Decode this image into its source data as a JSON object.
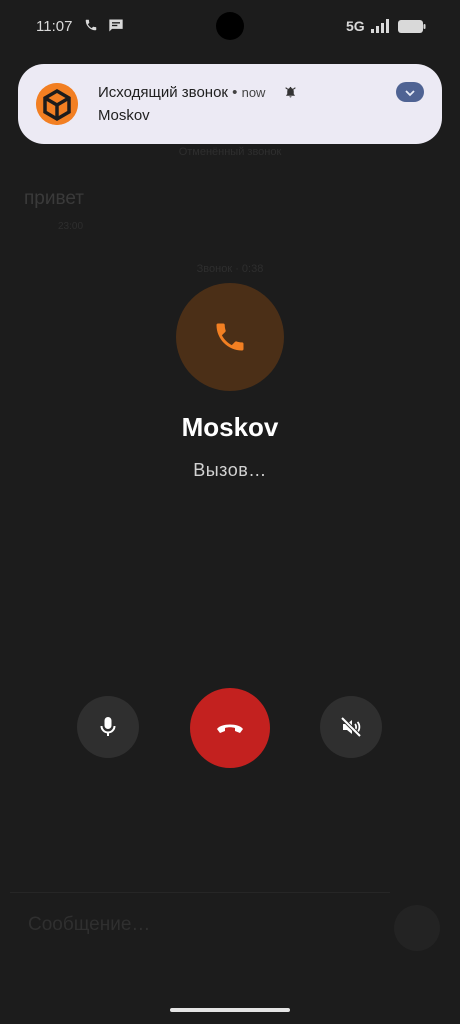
{
  "status_bar": {
    "time": "11:07",
    "network": "5G",
    "icons": [
      "phone-icon",
      "message-icon",
      "signal-icon",
      "battery-icon"
    ]
  },
  "background_chat": {
    "system_message_top": "Отменённый звонок",
    "message_text": "привет",
    "message_time": "23:00",
    "system_message_call": "Звонок · 0:38",
    "input_placeholder": "Сообщение…"
  },
  "notification": {
    "title": "Исходящий звонок",
    "separator": "•",
    "time": "now",
    "subtitle": "Moskov",
    "app_icon": "app-logo-icon",
    "bell_icon": "bell-icon",
    "expand_icon": "chevron-down-icon"
  },
  "call": {
    "name": "Moskov",
    "status": "Вызов…",
    "avatar_icon": "phone-icon"
  },
  "controls": {
    "mic": "microphone-icon",
    "end_call": "end-call-icon",
    "speaker": "speaker-muted-icon"
  },
  "colors": {
    "background": "#1c1c1c",
    "notification_bg": "#eceaf4",
    "accent_orange": "#f27f22",
    "avatar_bg": "#4b2f17",
    "end_call_red": "#c3211f",
    "control_bg": "#2f2f2f"
  }
}
